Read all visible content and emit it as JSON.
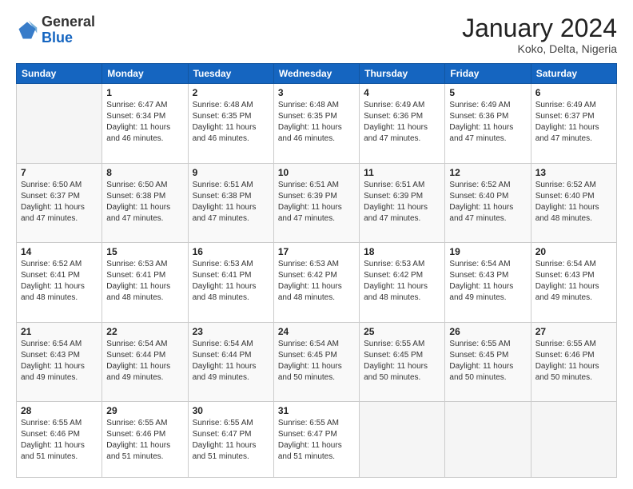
{
  "logo": {
    "general": "General",
    "blue": "Blue"
  },
  "title": "January 2024",
  "location": "Koko, Delta, Nigeria",
  "days_header": [
    "Sunday",
    "Monday",
    "Tuesday",
    "Wednesday",
    "Thursday",
    "Friday",
    "Saturday"
  ],
  "weeks": [
    [
      {
        "num": "",
        "info": ""
      },
      {
        "num": "1",
        "info": "Sunrise: 6:47 AM\nSunset: 6:34 PM\nDaylight: 11 hours\nand 46 minutes."
      },
      {
        "num": "2",
        "info": "Sunrise: 6:48 AM\nSunset: 6:35 PM\nDaylight: 11 hours\nand 46 minutes."
      },
      {
        "num": "3",
        "info": "Sunrise: 6:48 AM\nSunset: 6:35 PM\nDaylight: 11 hours\nand 46 minutes."
      },
      {
        "num": "4",
        "info": "Sunrise: 6:49 AM\nSunset: 6:36 PM\nDaylight: 11 hours\nand 47 minutes."
      },
      {
        "num": "5",
        "info": "Sunrise: 6:49 AM\nSunset: 6:36 PM\nDaylight: 11 hours\nand 47 minutes."
      },
      {
        "num": "6",
        "info": "Sunrise: 6:49 AM\nSunset: 6:37 PM\nDaylight: 11 hours\nand 47 minutes."
      }
    ],
    [
      {
        "num": "7",
        "info": "Sunrise: 6:50 AM\nSunset: 6:37 PM\nDaylight: 11 hours\nand 47 minutes."
      },
      {
        "num": "8",
        "info": "Sunrise: 6:50 AM\nSunset: 6:38 PM\nDaylight: 11 hours\nand 47 minutes."
      },
      {
        "num": "9",
        "info": "Sunrise: 6:51 AM\nSunset: 6:38 PM\nDaylight: 11 hours\nand 47 minutes."
      },
      {
        "num": "10",
        "info": "Sunrise: 6:51 AM\nSunset: 6:39 PM\nDaylight: 11 hours\nand 47 minutes."
      },
      {
        "num": "11",
        "info": "Sunrise: 6:51 AM\nSunset: 6:39 PM\nDaylight: 11 hours\nand 47 minutes."
      },
      {
        "num": "12",
        "info": "Sunrise: 6:52 AM\nSunset: 6:40 PM\nDaylight: 11 hours\nand 47 minutes."
      },
      {
        "num": "13",
        "info": "Sunrise: 6:52 AM\nSunset: 6:40 PM\nDaylight: 11 hours\nand 48 minutes."
      }
    ],
    [
      {
        "num": "14",
        "info": "Sunrise: 6:52 AM\nSunset: 6:41 PM\nDaylight: 11 hours\nand 48 minutes."
      },
      {
        "num": "15",
        "info": "Sunrise: 6:53 AM\nSunset: 6:41 PM\nDaylight: 11 hours\nand 48 minutes."
      },
      {
        "num": "16",
        "info": "Sunrise: 6:53 AM\nSunset: 6:41 PM\nDaylight: 11 hours\nand 48 minutes."
      },
      {
        "num": "17",
        "info": "Sunrise: 6:53 AM\nSunset: 6:42 PM\nDaylight: 11 hours\nand 48 minutes."
      },
      {
        "num": "18",
        "info": "Sunrise: 6:53 AM\nSunset: 6:42 PM\nDaylight: 11 hours\nand 48 minutes."
      },
      {
        "num": "19",
        "info": "Sunrise: 6:54 AM\nSunset: 6:43 PM\nDaylight: 11 hours\nand 49 minutes."
      },
      {
        "num": "20",
        "info": "Sunrise: 6:54 AM\nSunset: 6:43 PM\nDaylight: 11 hours\nand 49 minutes."
      }
    ],
    [
      {
        "num": "21",
        "info": "Sunrise: 6:54 AM\nSunset: 6:43 PM\nDaylight: 11 hours\nand 49 minutes."
      },
      {
        "num": "22",
        "info": "Sunrise: 6:54 AM\nSunset: 6:44 PM\nDaylight: 11 hours\nand 49 minutes."
      },
      {
        "num": "23",
        "info": "Sunrise: 6:54 AM\nSunset: 6:44 PM\nDaylight: 11 hours\nand 49 minutes."
      },
      {
        "num": "24",
        "info": "Sunrise: 6:54 AM\nSunset: 6:45 PM\nDaylight: 11 hours\nand 50 minutes."
      },
      {
        "num": "25",
        "info": "Sunrise: 6:55 AM\nSunset: 6:45 PM\nDaylight: 11 hours\nand 50 minutes."
      },
      {
        "num": "26",
        "info": "Sunrise: 6:55 AM\nSunset: 6:45 PM\nDaylight: 11 hours\nand 50 minutes."
      },
      {
        "num": "27",
        "info": "Sunrise: 6:55 AM\nSunset: 6:46 PM\nDaylight: 11 hours\nand 50 minutes."
      }
    ],
    [
      {
        "num": "28",
        "info": "Sunrise: 6:55 AM\nSunset: 6:46 PM\nDaylight: 11 hours\nand 51 minutes."
      },
      {
        "num": "29",
        "info": "Sunrise: 6:55 AM\nSunset: 6:46 PM\nDaylight: 11 hours\nand 51 minutes."
      },
      {
        "num": "30",
        "info": "Sunrise: 6:55 AM\nSunset: 6:47 PM\nDaylight: 11 hours\nand 51 minutes."
      },
      {
        "num": "31",
        "info": "Sunrise: 6:55 AM\nSunset: 6:47 PM\nDaylight: 11 hours\nand 51 minutes."
      },
      {
        "num": "",
        "info": ""
      },
      {
        "num": "",
        "info": ""
      },
      {
        "num": "",
        "info": ""
      }
    ]
  ]
}
